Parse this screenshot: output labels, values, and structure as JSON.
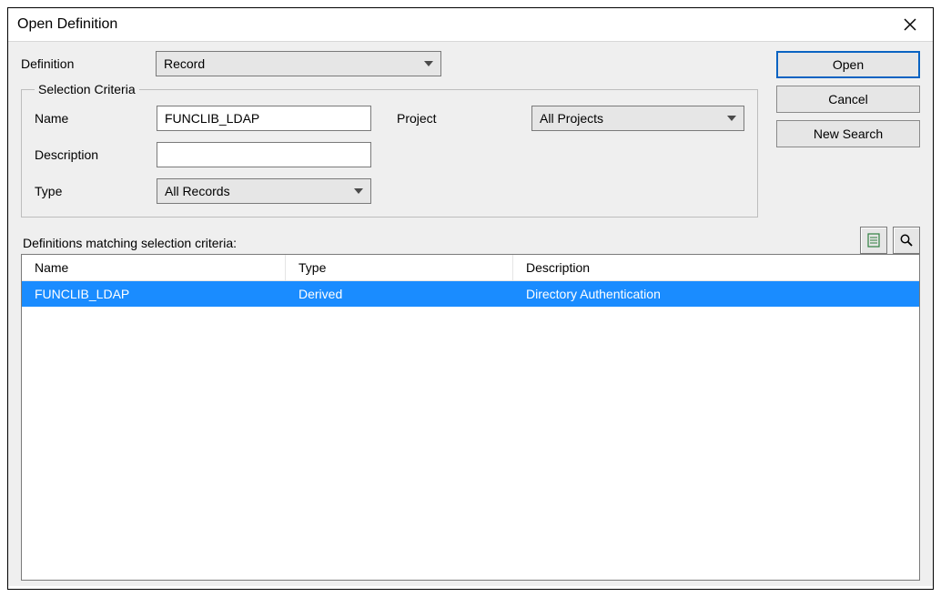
{
  "dialog": {
    "title": "Open Definition"
  },
  "definition": {
    "label": "Definition",
    "value": "Record"
  },
  "selection": {
    "legend": "Selection Criteria",
    "name_label": "Name",
    "name_value": "FUNCLIB_LDAP",
    "project_label": "Project",
    "project_value": "All Projects",
    "description_label": "Description",
    "description_value": "",
    "type_label": "Type",
    "type_value": "All Records"
  },
  "buttons": {
    "open": "Open",
    "cancel": "Cancel",
    "new_search": "New Search"
  },
  "results": {
    "label": "Definitions matching selection criteria:",
    "columns": {
      "name": "Name",
      "type": "Type",
      "description": "Description"
    },
    "rows": [
      {
        "name": "FUNCLIB_LDAP",
        "type": "Derived",
        "description": "Directory Authentication",
        "selected": true
      }
    ]
  }
}
